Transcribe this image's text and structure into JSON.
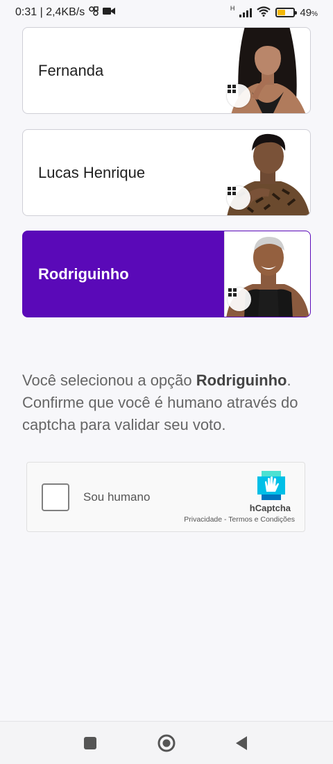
{
  "status_bar": {
    "time_speed": "0:31 | 2,4KB/s",
    "network": "H",
    "battery": "49",
    "battery_unit": "%",
    "battery_level": 0.49
  },
  "candidates": [
    {
      "name": "Fernanda",
      "selected": false
    },
    {
      "name": "Lucas Henrique",
      "selected": false
    },
    {
      "name": "Rodriguinho",
      "selected": true
    }
  ],
  "confirmation": {
    "prefix": "Você selecionou a opção ",
    "choice": "Rodriguinho",
    "suffix": ". Confirme que você é humano através do captcha para validar seu voto."
  },
  "captcha": {
    "label": "Sou humano",
    "brand": "hCaptcha",
    "privacy": "Privacidade",
    "separator": " - ",
    "terms": "Termos e Condições"
  },
  "colors": {
    "accent": "#5a09b8",
    "captcha_brand": "#1ea5d6"
  }
}
